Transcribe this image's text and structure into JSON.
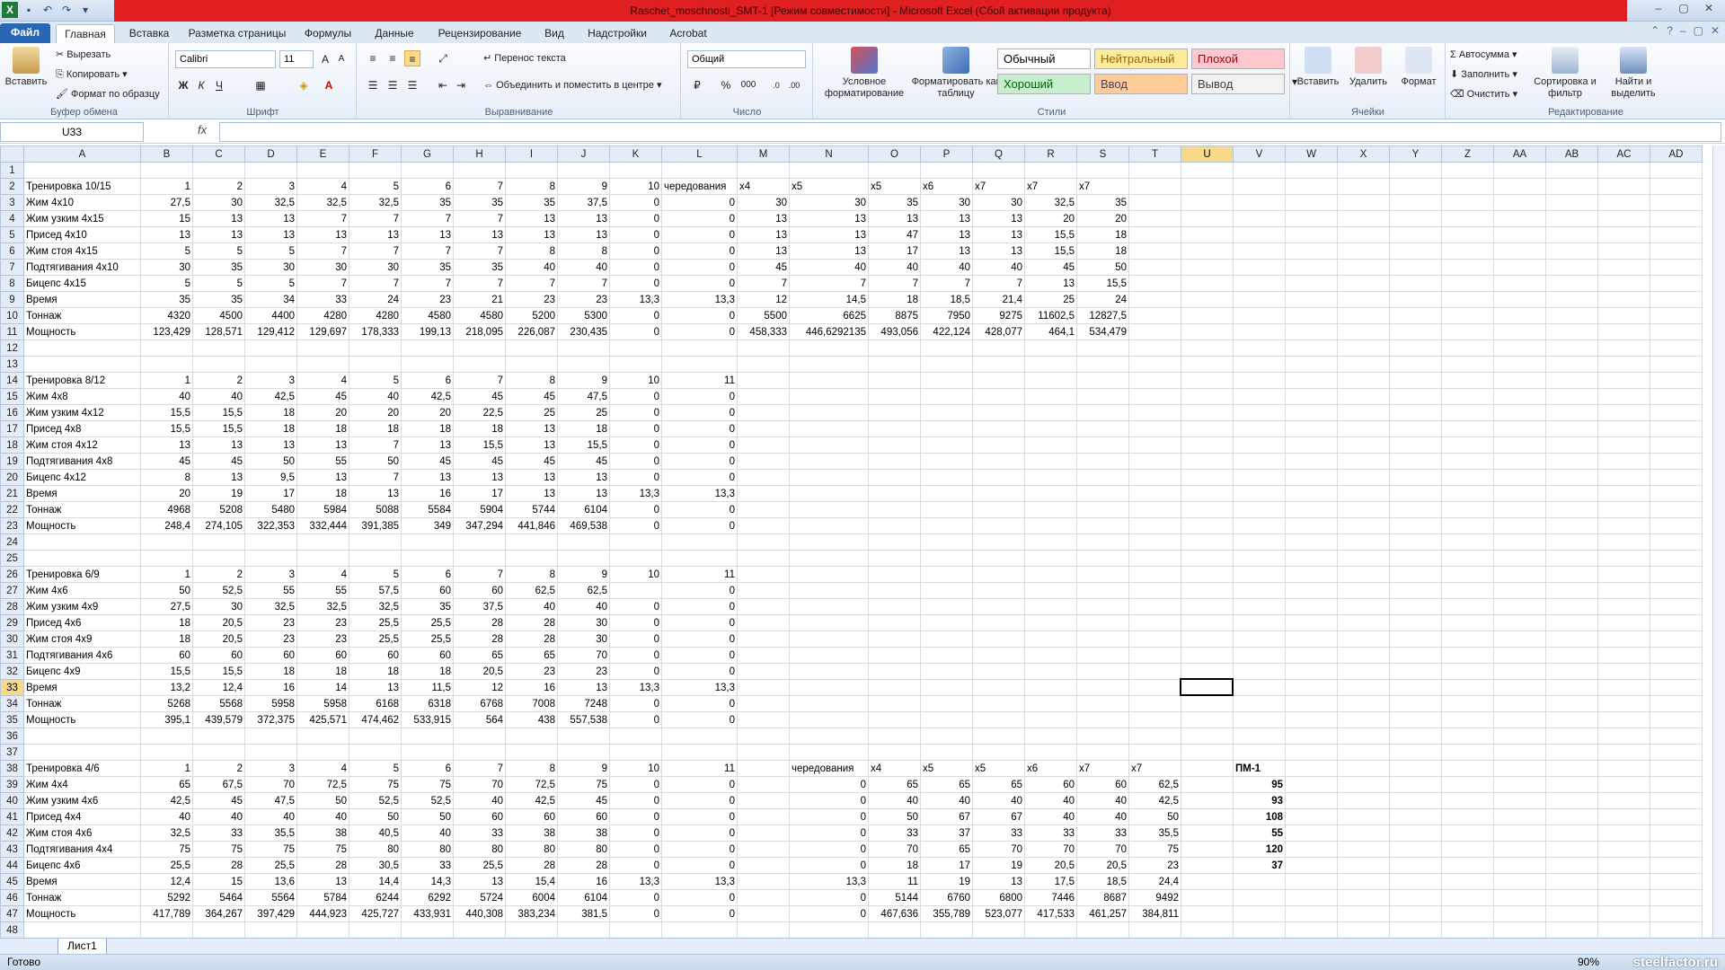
{
  "window": {
    "title": "Raschet_moschnosti_SMT-1  [Режим совместимости] - Microsoft Excel (Сбой активации продукта)",
    "controls": [
      "–",
      "▢",
      "✕"
    ]
  },
  "ribbon_tabs": [
    "Файл",
    "Главная",
    "Вставка",
    "Разметка страницы",
    "Формулы",
    "Данные",
    "Рецензирование",
    "Вид",
    "Надстройки",
    "Acrobat"
  ],
  "ribbon": {
    "clipboard": {
      "paste": "Вставить",
      "cut": "Вырезать",
      "copy": "Копировать",
      "painter": "Формат по образцу",
      "label": "Буфер обмена"
    },
    "font": {
      "name": "Calibri",
      "size": "11",
      "label": "Шрифт",
      "bold": "Ж",
      "italic": "К",
      "underline": "Ч"
    },
    "alignment": {
      "wrap": "Перенос текста",
      "merge": "Объединить и поместить в центре",
      "label": "Выравнивание"
    },
    "number": {
      "format": "Общий",
      "label": "Число",
      "percent": "%",
      "thousands": "000"
    },
    "styles": {
      "conditional": "Условное форматирование",
      "table": "Форматировать как таблицу",
      "label": "Стили",
      "cells": [
        {
          "text": "Обычный",
          "bg": "#ffffff",
          "fg": "#000000"
        },
        {
          "text": "Нейтральный",
          "bg": "#ffeb9c",
          "fg": "#9c6500"
        },
        {
          "text": "Плохой",
          "bg": "#ffc7ce",
          "fg": "#9c0006"
        },
        {
          "text": "Хороший",
          "bg": "#c6efce",
          "fg": "#006100"
        },
        {
          "text": "Ввод",
          "bg": "#ffcc99",
          "fg": "#3f3f76"
        },
        {
          "text": "Вывод",
          "bg": "#f2f2f2",
          "fg": "#3f3f3f"
        }
      ]
    },
    "cells": {
      "insert": "Вставить",
      "delete": "Удалить",
      "format": "Формат",
      "label": "Ячейки"
    },
    "editing": {
      "autosum": "Автосумма",
      "fill": "Заполнить",
      "clear": "Очистить",
      "sort": "Сортировка и фильтр",
      "find": "Найти и выделить",
      "label": "Редактирование"
    }
  },
  "formula_bar": {
    "name_box": "U33",
    "fx": "fx",
    "formula": ""
  },
  "columns": [
    "A",
    "B",
    "C",
    "D",
    "E",
    "F",
    "G",
    "H",
    "I",
    "J",
    "K",
    "L",
    "M",
    "N",
    "O",
    "P",
    "Q",
    "R",
    "S",
    "T",
    "U",
    "V",
    "W",
    "X",
    "Y",
    "Z",
    "AA",
    "AB",
    "AC",
    "AD"
  ],
  "selected": {
    "col": "U",
    "row": "33"
  },
  "rows": [
    {
      "n": "1",
      "c": []
    },
    {
      "n": "2",
      "c": [
        "Тренировка 10/15",
        "1",
        "2",
        "3",
        "4",
        "5",
        "6",
        "7",
        "8",
        "9",
        "10",
        "чередования",
        "x4",
        "x5",
        "x5",
        "x6",
        "x7",
        "x7",
        "x7"
      ]
    },
    {
      "n": "3",
      "c": [
        "Жим 4x10",
        "27,5",
        "30",
        "32,5",
        "32,5",
        "32,5",
        "35",
        "35",
        "35",
        "37,5",
        "0",
        "0",
        "30",
        "30",
        "35",
        "30",
        "30",
        "32,5",
        "35"
      ]
    },
    {
      "n": "4",
      "c": [
        "Жим узким 4x15",
        "15",
        "13",
        "13",
        "7",
        "7",
        "7",
        "7",
        "13",
        "13",
        "0",
        "0",
        "13",
        "13",
        "13",
        "13",
        "13",
        "20",
        "20"
      ]
    },
    {
      "n": "5",
      "c": [
        "Присед 4x10",
        "13",
        "13",
        "13",
        "13",
        "13",
        "13",
        "13",
        "13",
        "13",
        "0",
        "0",
        "13",
        "13",
        "47",
        "13",
        "13",
        "15,5",
        "18"
      ]
    },
    {
      "n": "6",
      "c": [
        "Жим стоя 4x15",
        "5",
        "5",
        "5",
        "7",
        "7",
        "7",
        "7",
        "8",
        "8",
        "0",
        "0",
        "13",
        "13",
        "17",
        "13",
        "13",
        "15,5",
        "18"
      ]
    },
    {
      "n": "7",
      "c": [
        "Подтягивания 4x10",
        "30",
        "35",
        "30",
        "30",
        "30",
        "35",
        "35",
        "40",
        "40",
        "0",
        "0",
        "45",
        "40",
        "40",
        "40",
        "40",
        "45",
        "50"
      ]
    },
    {
      "n": "8",
      "c": [
        "Бицепс 4x15",
        "5",
        "5",
        "5",
        "7",
        "7",
        "7",
        "7",
        "7",
        "7",
        "0",
        "0",
        "7",
        "7",
        "7",
        "7",
        "7",
        "13",
        "15,5"
      ]
    },
    {
      "n": "9",
      "c": [
        "Время",
        "35",
        "35",
        "34",
        "33",
        "24",
        "23",
        "21",
        "23",
        "23",
        "13,3",
        "13,3",
        "12",
        "14,5",
        "18",
        "18,5",
        "21,4",
        "25",
        "24"
      ]
    },
    {
      "n": "10",
      "c": [
        "Тоннаж",
        "4320",
        "4500",
        "4400",
        "4280",
        "4280",
        "4580",
        "4580",
        "5200",
        "5300",
        "0",
        "0",
        "5500",
        "6625",
        "8875",
        "7950",
        "9275",
        "11602,5",
        "12827,5"
      ]
    },
    {
      "n": "11",
      "c": [
        "Мощность",
        "123,429",
        "128,571",
        "129,412",
        "129,697",
        "178,333",
        "199,13",
        "218,095",
        "226,087",
        "230,435",
        "0",
        "0",
        "458,333",
        "446,6292135",
        "493,056",
        "422,124",
        "428,077",
        "464,1",
        "534,479"
      ]
    },
    {
      "n": "12",
      "c": []
    },
    {
      "n": "13",
      "c": []
    },
    {
      "n": "14",
      "c": [
        "Тренировка 8/12",
        "1",
        "2",
        "3",
        "4",
        "5",
        "6",
        "7",
        "8",
        "9",
        "10",
        "11"
      ]
    },
    {
      "n": "15",
      "c": [
        "Жим 4x8",
        "40",
        "40",
        "42,5",
        "45",
        "40",
        "42,5",
        "45",
        "45",
        "47,5",
        "0",
        "0"
      ]
    },
    {
      "n": "16",
      "c": [
        "Жим узким 4x12",
        "15,5",
        "15,5",
        "18",
        "20",
        "20",
        "20",
        "22,5",
        "25",
        "25",
        "0",
        "0"
      ]
    },
    {
      "n": "17",
      "c": [
        "Присед 4x8",
        "15,5",
        "15,5",
        "18",
        "18",
        "18",
        "18",
        "18",
        "13",
        "18",
        "0",
        "0"
      ]
    },
    {
      "n": "18",
      "c": [
        "Жим стоя 4x12",
        "13",
        "13",
        "13",
        "13",
        "7",
        "13",
        "15,5",
        "13",
        "15,5",
        "0",
        "0"
      ]
    },
    {
      "n": "19",
      "c": [
        "Подтягивания 4x8",
        "45",
        "45",
        "50",
        "55",
        "50",
        "45",
        "45",
        "45",
        "45",
        "0",
        "0"
      ]
    },
    {
      "n": "20",
      "c": [
        "Бицепс 4x12",
        "8",
        "13",
        "9,5",
        "13",
        "7",
        "13",
        "13",
        "13",
        "13",
        "0",
        "0"
      ]
    },
    {
      "n": "21",
      "c": [
        "Время",
        "20",
        "19",
        "17",
        "18",
        "13",
        "16",
        "17",
        "13",
        "13",
        "13,3",
        "13,3"
      ]
    },
    {
      "n": "22",
      "c": [
        "Тоннаж",
        "4968",
        "5208",
        "5480",
        "5984",
        "5088",
        "5584",
        "5904",
        "5744",
        "6104",
        "0",
        "0"
      ]
    },
    {
      "n": "23",
      "c": [
        "Мощность",
        "248,4",
        "274,105",
        "322,353",
        "332,444",
        "391,385",
        "349",
        "347,294",
        "441,846",
        "469,538",
        "0",
        "0"
      ]
    },
    {
      "n": "24",
      "c": []
    },
    {
      "n": "25",
      "c": []
    },
    {
      "n": "26",
      "c": [
        "Тренировка 6/9",
        "1",
        "2",
        "3",
        "4",
        "5",
        "6",
        "7",
        "8",
        "9",
        "10",
        "11"
      ]
    },
    {
      "n": "27",
      "c": [
        "Жим 4x6",
        "50",
        "52,5",
        "55",
        "55",
        "57,5",
        "60",
        "60",
        "62,5",
        "62,5",
        "",
        "0"
      ]
    },
    {
      "n": "28",
      "c": [
        "Жим узким 4x9",
        "27,5",
        "30",
        "32,5",
        "32,5",
        "32,5",
        "35",
        "37,5",
        "40",
        "40",
        "0",
        "0"
      ]
    },
    {
      "n": "29",
      "c": [
        "Присед 4x6",
        "18",
        "20,5",
        "23",
        "23",
        "25,5",
        "25,5",
        "28",
        "28",
        "30",
        "0",
        "0"
      ]
    },
    {
      "n": "30",
      "c": [
        "Жим стоя 4x9",
        "18",
        "20,5",
        "23",
        "23",
        "25,5",
        "25,5",
        "28",
        "28",
        "30",
        "0",
        "0"
      ]
    },
    {
      "n": "31",
      "c": [
        "Подтягивания 4x6",
        "60",
        "60",
        "60",
        "60",
        "60",
        "60",
        "65",
        "65",
        "70",
        "0",
        "0"
      ]
    },
    {
      "n": "32",
      "c": [
        "Бицепс 4x9",
        "15,5",
        "15,5",
        "18",
        "18",
        "18",
        "18",
        "20,5",
        "23",
        "23",
        "0",
        "0"
      ]
    },
    {
      "n": "33",
      "c": [
        "Время",
        "13,2",
        "12,4",
        "16",
        "14",
        "13",
        "11,5",
        "12",
        "16",
        "13",
        "13,3",
        "13,3"
      ]
    },
    {
      "n": "34",
      "c": [
        "Тоннаж",
        "5268",
        "5568",
        "5958",
        "5958",
        "6168",
        "6318",
        "6768",
        "7008",
        "7248",
        "0",
        "0"
      ]
    },
    {
      "n": "35",
      "c": [
        "Мощность",
        "395,1",
        "439,579",
        "372,375",
        "425,571",
        "474,462",
        "533,915",
        "564",
        "438",
        "557,538",
        "0",
        "0"
      ]
    },
    {
      "n": "36",
      "c": []
    },
    {
      "n": "37",
      "c": []
    },
    {
      "n": "38",
      "c": [
        "Тренировка 4/6",
        "1",
        "2",
        "3",
        "4",
        "5",
        "6",
        "7",
        "8",
        "9",
        "10",
        "11",
        "",
        "чередования",
        "x4",
        "x5",
        "x5",
        "x6",
        "x7",
        "x7",
        "",
        "ПМ-1"
      ]
    },
    {
      "n": "39",
      "c": [
        "Жим 4x4",
        "65",
        "67,5",
        "70",
        "72,5",
        "75",
        "75",
        "70",
        "72,5",
        "75",
        "0",
        "0",
        "",
        "0",
        "65",
        "65",
        "65",
        "60",
        "60",
        "62,5",
        "",
        "95"
      ]
    },
    {
      "n": "40",
      "c": [
        "Жим узким 4x6",
        "42,5",
        "45",
        "47,5",
        "50",
        "52,5",
        "52,5",
        "40",
        "42,5",
        "45",
        "0",
        "0",
        "",
        "0",
        "40",
        "40",
        "40",
        "40",
        "40",
        "42,5",
        "",
        "93"
      ]
    },
    {
      "n": "41",
      "c": [
        "Присед 4x4",
        "40",
        "40",
        "40",
        "40",
        "50",
        "50",
        "60",
        "60",
        "60",
        "0",
        "0",
        "",
        "0",
        "50",
        "67",
        "67",
        "40",
        "40",
        "50",
        "",
        "108"
      ]
    },
    {
      "n": "42",
      "c": [
        "Жим стоя 4x6",
        "32,5",
        "33",
        "35,5",
        "38",
        "40,5",
        "40",
        "33",
        "38",
        "38",
        "0",
        "0",
        "",
        "0",
        "33",
        "37",
        "33",
        "33",
        "33",
        "35,5",
        "",
        "55"
      ]
    },
    {
      "n": "43",
      "c": [
        "Подтягивания 4x4",
        "75",
        "75",
        "75",
        "75",
        "80",
        "80",
        "80",
        "80",
        "80",
        "0",
        "0",
        "",
        "0",
        "70",
        "65",
        "70",
        "70",
        "70",
        "75",
        "",
        "120"
      ]
    },
    {
      "n": "44",
      "c": [
        "Бицепс 4x6",
        "25,5",
        "28",
        "25,5",
        "28",
        "30,5",
        "33",
        "25,5",
        "28",
        "28",
        "0",
        "0",
        "",
        "0",
        "18",
        "17",
        "19",
        "20,5",
        "20,5",
        "23",
        "",
        "37"
      ]
    },
    {
      "n": "45",
      "c": [
        "Время",
        "12,4",
        "15",
        "13,6",
        "13",
        "14,4",
        "14,3",
        "13",
        "15,4",
        "16",
        "13,3",
        "13,3",
        "",
        "13,3",
        "11",
        "19",
        "13",
        "17,5",
        "18,5",
        "24,4"
      ]
    },
    {
      "n": "46",
      "c": [
        "Тоннаж",
        "5292",
        "5464",
        "5564",
        "5784",
        "6244",
        "6292",
        "5724",
        "6004",
        "6104",
        "0",
        "0",
        "",
        "0",
        "5144",
        "6760",
        "6800",
        "7446",
        "8687",
        "9492"
      ]
    },
    {
      "n": "47",
      "c": [
        "Мощность",
        "417,789",
        "364,267",
        "397,429",
        "444,923",
        "425,727",
        "433,931",
        "440,308",
        "383,234",
        "381,5",
        "0",
        "0",
        "",
        "0",
        "467,636",
        "355,789",
        "523,077",
        "417,533",
        "461,257",
        "384,811"
      ]
    },
    {
      "n": "48",
      "c": []
    }
  ],
  "sheet_tab": "Лист1",
  "status": {
    "ready": "Готово",
    "zoom": "90%",
    "watermark": "steelfactor.ru"
  }
}
